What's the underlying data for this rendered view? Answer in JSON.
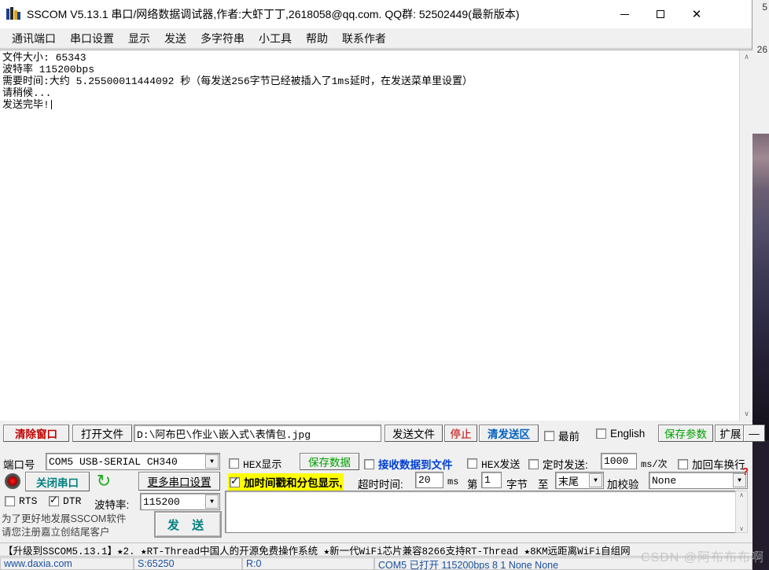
{
  "window": {
    "title": "SSCOM V5.13.1 串口/网络数据调试器,作者:大虾丁丁,2618058@qq.com. QQ群: 52502449(最新版本)",
    "minimize": "—",
    "maximize": "□",
    "close": "✕"
  },
  "menu": {
    "items": [
      {
        "label": "通讯端口"
      },
      {
        "label": "串口设置"
      },
      {
        "label": "显示"
      },
      {
        "label": "发送"
      },
      {
        "label": "多字符串"
      },
      {
        "label": "小工具"
      },
      {
        "label": "帮助"
      },
      {
        "label": "联系作者"
      }
    ]
  },
  "receive": {
    "lines": [
      "文件大小: 65343",
      "波特率 115200bps",
      "需要时间:大约 5.25500011444092 秒（每发送256字节已经被插入了1ms延时，在发送菜单里设置）",
      "请稍候...",
      "发送完毕!"
    ],
    "scroll_up": "∧",
    "scroll_down": "∨"
  },
  "toolbar_row1": {
    "clear_window": "清除窗口",
    "open_file": "打开文件",
    "file_path": "D:\\阿布巴\\作业\\嵌入式\\表情包.jpg",
    "send_file": "发送文件",
    "stop": "停止",
    "clear_send": "清发送区",
    "topmost": "最前",
    "topmost_checked": false,
    "english": "English",
    "english_checked": false,
    "save_params": "保存参数",
    "extend": "扩展",
    "collapse": "—"
  },
  "toolbar_row2": {
    "port_label": "端口号",
    "port_value": "COM5 USB-SERIAL CH340",
    "hex_display": "HEX显示",
    "hex_display_checked": false,
    "save_data": "保存数据",
    "recv_to_file": "接收数据到文件",
    "recv_to_file_checked": false,
    "hex_send": "HEX发送",
    "hex_send_checked": false,
    "timed_send": "定时发送:",
    "timed_send_checked": false,
    "interval_value": "1000",
    "interval_unit": "ms/次",
    "add_crlf": "加回车换行",
    "add_crlf_checked": false
  },
  "toolbar_row3": {
    "close_port": "关闭串口",
    "more_settings": "更多串口设置",
    "refresh_icon": "↻",
    "timestamp_label": "加时间戳和分包显示,",
    "timestamp_checked": true,
    "timeout_label": "超时时间:",
    "timeout_value": "20",
    "timeout_unit": "ms",
    "byte_prefix": "第",
    "byte_index": "1",
    "byte_label": "字节",
    "to_label": "至",
    "to_value": "末尾",
    "checksum_label": "加校验",
    "checksum_value": "None"
  },
  "toolbar_row4": {
    "rts": "RTS",
    "rts_checked": false,
    "dtr": "DTR",
    "dtr_checked": true,
    "baud_label": "波特率:",
    "baud_value": "115200"
  },
  "register_note": {
    "line1": "为了更好地发展SSCOM软件",
    "line2": "请您注册嘉立创结尾客户",
    "send_button": "发 送"
  },
  "help_badge": "?",
  "promo": {
    "text": "【升级到SSCOM5.13.1】★2.  ★RT-Thread中国人的开源免费操作系统 ★新一代WiFi芯片兼容8266支持RT-Thread ★8KM远距离WiFi自组网"
  },
  "statusbar": {
    "cells": [
      "www.daxia.com",
      "S:65250",
      "R:0",
      "COM5 已打开 115200bps 8 1 None None"
    ]
  },
  "watermark": "CSDN @阿布布布啊",
  "background": {
    "edge_text_top": "5",
    "edge_text_mid": "26"
  }
}
